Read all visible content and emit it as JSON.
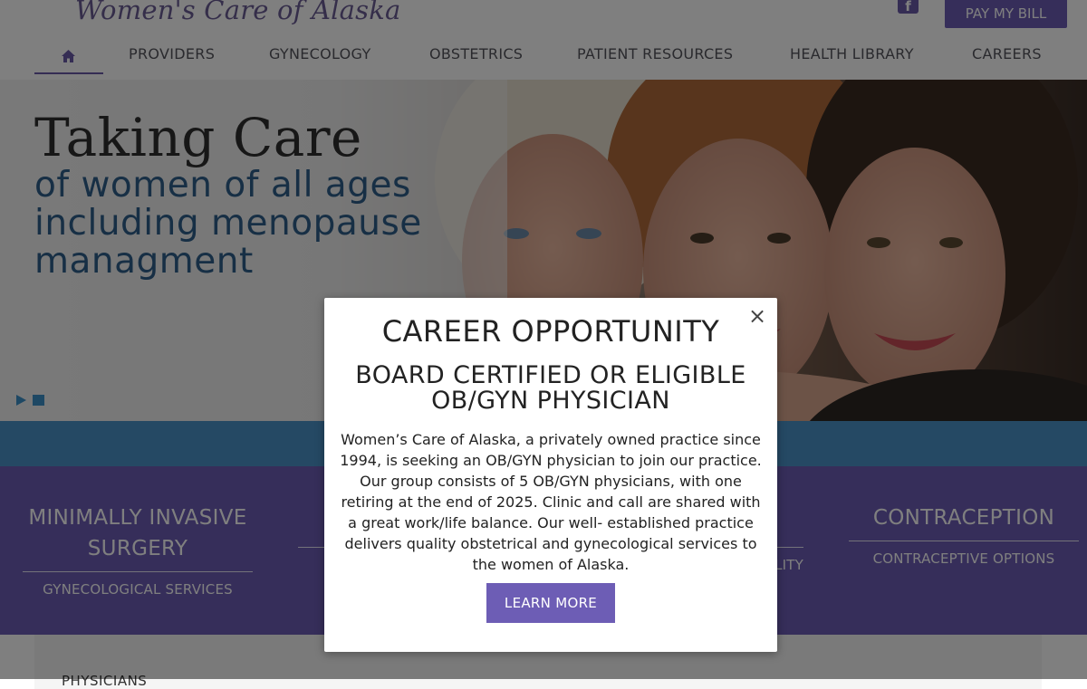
{
  "header": {
    "logo_text": "Women's Care of Alaska",
    "facebook_icon": "facebook-icon",
    "pay_button": "PAY MY BILL"
  },
  "nav": {
    "home_icon": "home-icon",
    "items": [
      {
        "label": "PROVIDERS"
      },
      {
        "label": "GYNECOLOGY"
      },
      {
        "label": "OBSTETRICS"
      },
      {
        "label": "PATIENT RESOURCES"
      },
      {
        "label": "HEALTH LIBRARY"
      },
      {
        "label": "CAREERS"
      }
    ]
  },
  "hero": {
    "title": "Taking Care",
    "subtitle_lines": [
      "of women of all ages",
      "including menopause",
      "managment"
    ],
    "controls": {
      "play_icon": "play-icon",
      "pause_icon": "pause-icon"
    }
  },
  "services": [
    {
      "title_lines": [
        "MINIMALLY INVASIVE",
        "SURGERY"
      ],
      "subtitle": "GYNECOLOGICAL SERVICES"
    },
    {
      "title_lines": [
        "CONTRACEPTION"
      ],
      "subtitle": "CONTRACEPTIVE OPTIONS"
    }
  ],
  "services_partial": {
    "subtitle_fragment": "LITY"
  },
  "page_body": {
    "section_label": "PHYSICIANS"
  },
  "modal": {
    "close_glyph": "×",
    "title": "CAREER OPPORTUNITY",
    "heading": "BOARD CERTIFIED OR ELIGIBLE OB/GYN PHYSICIAN",
    "body": "Women’s Care of Alaska, a privately owned practice since 1994, is seeking an OB/GYN physician to join our practice. Our group consists of 5 OB/GYN physicians, with one retiring at the end of 2025. Clinic and call are shared with a great work/life balance. Our well- established practice delivers quality obstetrical and gynecological services to the women of Alaska.",
    "button": "LEARN MORE"
  },
  "colors": {
    "brand_purple": "#6d5db5",
    "hero_blue": "#2e5f8a",
    "band_blue": "#4b93c8"
  }
}
